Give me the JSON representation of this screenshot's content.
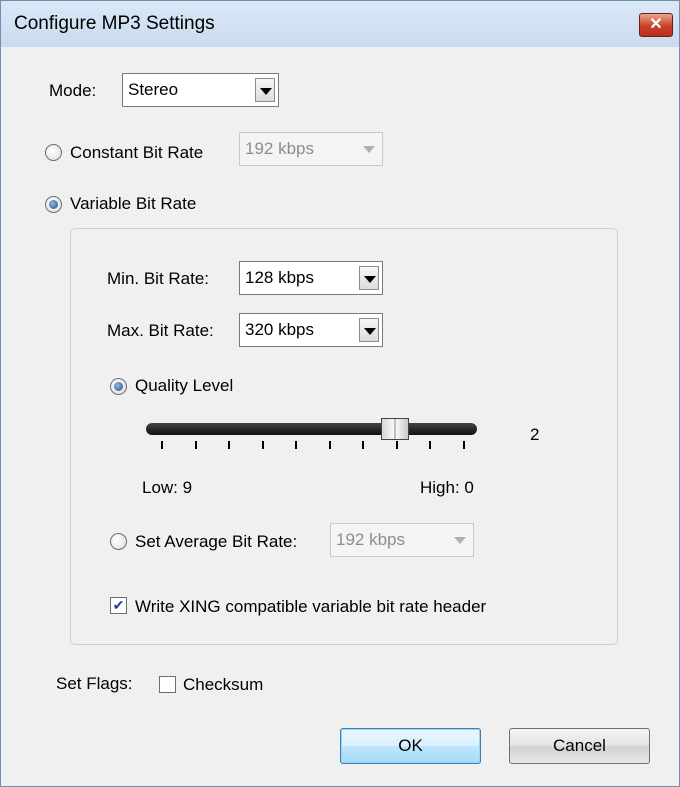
{
  "window": {
    "title": "Configure MP3 Settings"
  },
  "mode": {
    "label": "Mode:",
    "value": "Stereo"
  },
  "cbr": {
    "label": "Constant Bit Rate",
    "value": "192 kbps",
    "checked": false
  },
  "vbr": {
    "label": "Variable Bit Rate",
    "checked": true,
    "min_label": "Min. Bit Rate:",
    "min_value": "128 kbps",
    "max_label": "Max. Bit Rate:",
    "max_value": "320 kbps",
    "quality": {
      "label": "Quality Level",
      "checked": true,
      "value": "2",
      "low_label": "Low: 9",
      "high_label": "High: 0"
    },
    "average": {
      "label": "Set Average Bit Rate:",
      "value": "192 kbps",
      "checked": false
    },
    "xing": {
      "label": "Write XING compatible variable bit rate header",
      "checked": true
    }
  },
  "flags": {
    "label": "Set Flags:",
    "checksum_label": "Checksum",
    "checksum_checked": false
  },
  "buttons": {
    "ok": "OK",
    "cancel": "Cancel"
  }
}
